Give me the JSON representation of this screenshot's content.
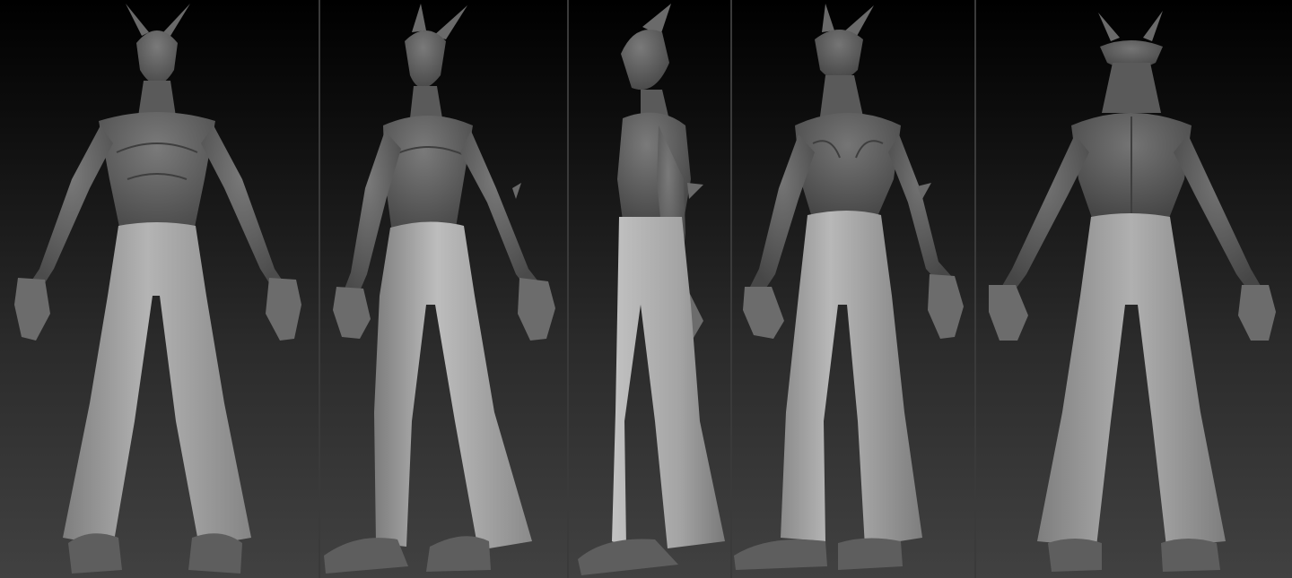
{
  "image": {
    "subject": "turnaround-sheet",
    "views": [
      {
        "key": "front"
      },
      {
        "key": "three-quarter-front"
      },
      {
        "key": "side"
      },
      {
        "key": "three-quarter-back"
      },
      {
        "key": "back"
      }
    ]
  },
  "colors": {
    "background_top": "#000000",
    "background_bottom": "#414141",
    "skin": "#6a6a6a",
    "skin_dark": "#4a4a4a",
    "pants": "#a9a9a9",
    "pants_shadow": "#7e7e7e",
    "boots": "#5e5e5e",
    "divider": "#3a3a3a"
  }
}
